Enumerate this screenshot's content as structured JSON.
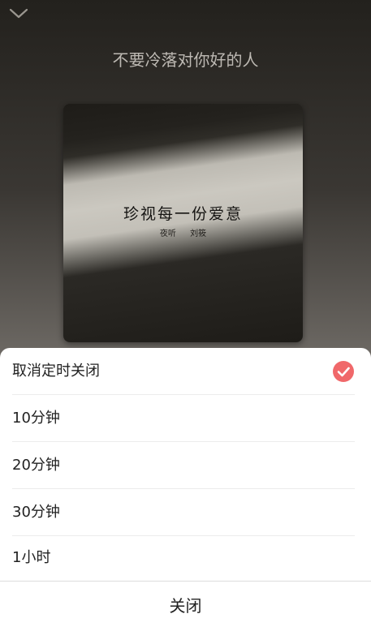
{
  "player": {
    "song_title": "不要冷落对你好的人",
    "album_art_text": "珍视每一份爱意",
    "album_art_subtext": "夜听 刘筱",
    "collapse_icon": "chevron-down-icon"
  },
  "timer_sheet": {
    "options": [
      {
        "label": "取消定时关闭",
        "selected": true
      },
      {
        "label": "10分钟",
        "selected": false
      },
      {
        "label": "20分钟",
        "selected": false
      },
      {
        "label": "30分钟",
        "selected": false
      },
      {
        "label": "1小时",
        "selected": false
      }
    ],
    "selected_icon": "check-circle-icon",
    "close_label": "关闭"
  },
  "colors": {
    "accent": "#f0686a",
    "sheet_background": "#ffffff",
    "text_primary": "#222222"
  }
}
